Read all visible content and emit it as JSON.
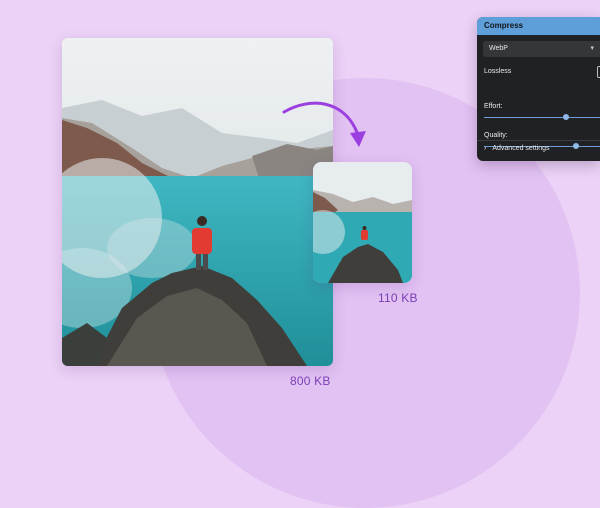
{
  "large_image": {
    "size_label": "800 KB"
  },
  "small_image": {
    "size_label": "110 KB"
  },
  "compress_panel": {
    "title": "Compress",
    "format": {
      "selected": "WebP"
    },
    "lossless": {
      "label": "Lossless",
      "checked": false
    },
    "effort": {
      "label": "Effort:",
      "value_fraction": 0.63
    },
    "quality": {
      "label": "Quality:",
      "value_fraction": 0.7
    },
    "advanced": {
      "label": "Advanced settings"
    }
  },
  "colors": {
    "background": "#ecd2f6",
    "circle": "#e2c2f3",
    "accent_purple": "#7b3fb4",
    "arrow": "#9b3fe0",
    "panel_bg": "#202124",
    "panel_header": "#5f9fd9",
    "slider": "#6a9fd6"
  },
  "icons": {
    "arrow": "curved-arrow-icon",
    "advanced_toggle": "chevron-right-icon",
    "select_toggle": "chevron-down-icon"
  }
}
